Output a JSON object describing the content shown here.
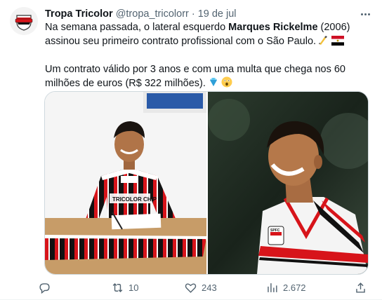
{
  "tweet": {
    "author_name": "Tropa Tricolor",
    "handle": "@tropa_tricolorr",
    "separator": "·",
    "date": "19 de jul",
    "text_p1_a": "Na semana passada, o lateral esquerdo ",
    "text_p1_b": "Marques Rickelme",
    "text_p1_c": " (2006) assinou seu primeiro contrato profissional com o São Paulo.",
    "text_p2": "Um contrato válido por 3 anos e com uma multa que chega nos 60 milhões de euros (R$ 322 milhões).",
    "photo1_jersey_text": "TRICOLOR CHIP",
    "photo2_badge_text": "SPFC"
  },
  "actions": {
    "reply_count": "",
    "retweet_count": "10",
    "like_count": "243",
    "views_count": "2.672"
  },
  "icons": {
    "avatar": "tropa-tricolor-logo",
    "more": "more-icon",
    "reply": "reply-icon",
    "retweet": "retweet-icon",
    "like": "heart-icon",
    "views": "views-icon",
    "share": "share-icon"
  },
  "colors": {
    "text": "#0f1419",
    "muted": "#536471",
    "spfc_red": "#d7141a"
  }
}
